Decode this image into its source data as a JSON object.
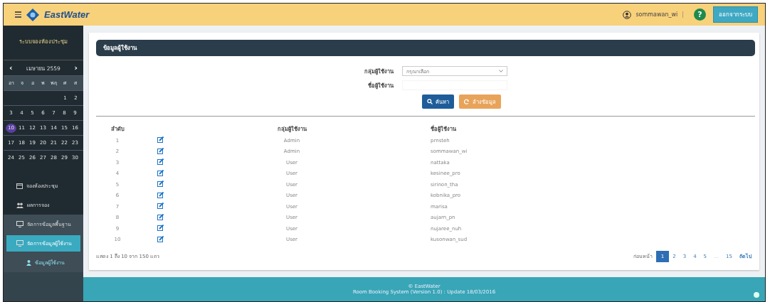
{
  "header": {
    "brand": "EastWater",
    "username": "sommawan_wi",
    "separator": "|",
    "help": "?",
    "logout": "ออกจากระบบ"
  },
  "sidebar": {
    "title": "ระบบจองห้องประชุม",
    "calendar": {
      "month": "เมษายน 2559",
      "prev": "‹",
      "next": "›",
      "weekdays": [
        "อา",
        "จ",
        "อ",
        "พ",
        "พฤ",
        "ศ",
        "ส"
      ],
      "weeks": [
        [
          {
            "day": "1",
            "selected": false
          },
          {
            "day": "2",
            "selected": false
          }
        ],
        [
          {
            "day": "3",
            "selected": false
          },
          {
            "day": "4",
            "selected": false
          },
          {
            "day": "5",
            "selected": false
          },
          {
            "day": "6",
            "selected": false
          },
          {
            "day": "7",
            "selected": false
          },
          {
            "day": "8",
            "selected": false
          },
          {
            "day": "9",
            "selected": false
          }
        ],
        [
          {
            "day": "10",
            "selected": true
          },
          {
            "day": "11",
            "selected": false
          },
          {
            "day": "12",
            "selected": false
          },
          {
            "day": "13",
            "selected": false
          },
          {
            "day": "14",
            "selected": false
          },
          {
            "day": "15",
            "selected": false
          },
          {
            "day": "16",
            "selected": false
          }
        ],
        [
          {
            "day": "17",
            "selected": false
          },
          {
            "day": "18",
            "selected": false
          },
          {
            "day": "19",
            "selected": false
          },
          {
            "day": "20",
            "selected": false
          },
          {
            "day": "21",
            "selected": false
          },
          {
            "day": "22",
            "selected": false
          },
          {
            "day": "23",
            "selected": false
          }
        ],
        [
          {
            "day": "24",
            "selected": false
          },
          {
            "day": "25",
            "selected": false
          },
          {
            "day": "26",
            "selected": false
          },
          {
            "day": "27",
            "selected": false
          },
          {
            "day": "28",
            "selected": false
          },
          {
            "day": "29",
            "selected": false
          },
          {
            "day": "30",
            "selected": false
          }
        ]
      ]
    },
    "items": [
      {
        "label": "จองห้องประชุม",
        "kind": "calendar",
        "selected": false
      },
      {
        "label": "ผลการจอง",
        "kind": "group",
        "selected": false
      },
      {
        "label": "จัดการข้อมูลพื้นฐาน",
        "kind": "monitor",
        "selected": false
      },
      {
        "label": "จัดการข้อมูลผู้ใช้งาน",
        "kind": "monitor",
        "selected": true,
        "children": [
          {
            "label": "ข้อมูลผู้ใช้งาน",
            "kind": "user",
            "selected": false
          }
        ]
      }
    ]
  },
  "panel": {
    "title": "ข้อมูลผู้ใช้งาน",
    "form": {
      "group_label": "กลุ่มผู้ใช้งาน",
      "group_value": "กรุณาเลือก",
      "name_label": "ชื่อผู้ใช้งาน",
      "search": "ค้นหา",
      "clear": "ล้างข้อมูล"
    },
    "table": {
      "columns": [
        "ลำดับ",
        "กลุ่มผู้ใช้งาน",
        "ชื่อผู้ใช้งาน"
      ],
      "rows": [
        {
          "no": "1",
          "group": "Admin",
          "name": "prnsteh"
        },
        {
          "no": "2",
          "group": "Admin",
          "name": "sommawan_wi"
        },
        {
          "no": "3",
          "group": "User",
          "name": "nattaka"
        },
        {
          "no": "4",
          "group": "User",
          "name": "kesinee_pro"
        },
        {
          "no": "5",
          "group": "User",
          "name": "sirinon_tha"
        },
        {
          "no": "6",
          "group": "User",
          "name": "kobnika_pro"
        },
        {
          "no": "7",
          "group": "User",
          "name": "marisa"
        },
        {
          "no": "8",
          "group": "User",
          "name": "aujarn_pn"
        },
        {
          "no": "9",
          "group": "User",
          "name": "nujaree_nuh"
        },
        {
          "no": "10",
          "group": "User",
          "name": "kusonwan_sud"
        }
      ]
    },
    "info": "แสดง 1 ถึง 10 จาก 150 แถว",
    "pagination": [
      {
        "label": "ก่อนหน้า",
        "kind": "nav",
        "selected": false
      },
      {
        "label": "1",
        "kind": "page",
        "selected": true
      },
      {
        "label": "2",
        "kind": "page",
        "selected": false
      },
      {
        "label": "3",
        "kind": "page",
        "selected": false
      },
      {
        "label": "4",
        "kind": "page",
        "selected": false
      },
      {
        "label": "5",
        "kind": "page",
        "selected": false
      },
      {
        "label": "…",
        "kind": "gap",
        "selected": false
      },
      {
        "label": "15",
        "kind": "page",
        "selected": false
      },
      {
        "label": "ถัดไป",
        "kind": "nav",
        "selected": false
      }
    ]
  },
  "footer": {
    "copyright": "© EastWater",
    "version": "Room Booking System (Version 1.0) : Update 18/03/2016"
  }
}
